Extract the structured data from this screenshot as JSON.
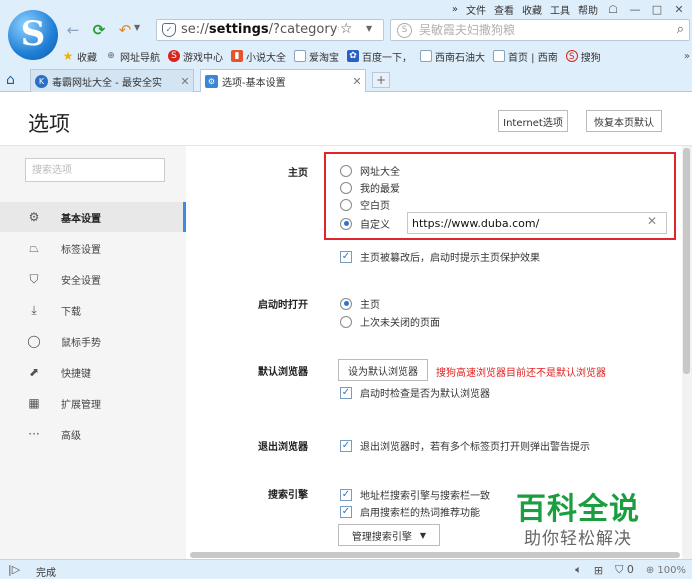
{
  "menubar": {
    "expand": "»",
    "items": [
      "文件",
      "查看",
      "收藏",
      "工具",
      "帮助"
    ]
  },
  "window": {
    "shirt": "☖",
    "minimize": "—",
    "restore": "□",
    "close": "✕"
  },
  "nav": {
    "address_prefix": "se://",
    "address_bold": "settings",
    "address_suffix": "/?category=ge"
  },
  "search": {
    "placeholder": "吴敏霞夫妇撒狗粮"
  },
  "bookmarks": {
    "items": [
      "收藏",
      "网址导航",
      "游戏中心",
      "小说大全",
      "爱淘宝",
      "百度一下，",
      "西南石油大",
      "首页 | 西南",
      "搜狗"
    ],
    "more": "»"
  },
  "tabs": [
    {
      "label": "毒霸网址大全 - 最安全实"
    },
    {
      "label": "选项-基本设置"
    }
  ],
  "page": {
    "title": "选项",
    "internet_options": "Internet选项",
    "restore_default": "恢复本页默认"
  },
  "sidebar": {
    "search_placeholder": "搜索选项",
    "items": [
      {
        "label": "基本设置",
        "icon": "gear-icon"
      },
      {
        "label": "标签设置",
        "icon": "tab-icon"
      },
      {
        "label": "安全设置",
        "icon": "shield-icon"
      },
      {
        "label": "下载",
        "icon": "download-icon"
      },
      {
        "label": "鼠标手势",
        "icon": "mouse-icon"
      },
      {
        "label": "快捷键",
        "icon": "shortcut-icon"
      },
      {
        "label": "扩展管理",
        "icon": "extensions-icon"
      },
      {
        "label": "高级",
        "icon": "more-icon"
      }
    ]
  },
  "settings": {
    "homepage": {
      "label": "主页",
      "options": [
        "网址大全",
        "我的最爱",
        "空白页",
        "自定义"
      ],
      "selected": "自定义",
      "custom_url": "https://www.duba.com/",
      "protect_check": "主页被篡改后，启动时提示主页保护效果"
    },
    "startup": {
      "label": "启动时打开",
      "options": [
        "主页",
        "上次未关闭的页面"
      ],
      "selected": "主页"
    },
    "default_browser": {
      "label": "默认浏览器",
      "button": "设为默认浏览器",
      "warning": "搜狗高速浏览器目前还不是默认浏览器",
      "check": "启动时检查是否为默认浏览器"
    },
    "exit_browser": {
      "label": "退出浏览器",
      "check": "退出浏览器时，若有多个标签页打开则弹出警告提示"
    },
    "search_engine": {
      "label": "搜索引擎",
      "check1": "地址栏搜索引擎与搜索栏一致",
      "check2": "启用搜索栏的热词推荐功能",
      "button": "管理搜索引擎"
    }
  },
  "watermark": {
    "title": "百科全说",
    "subtitle": "助你轻松解决"
  },
  "status": {
    "text": "完成",
    "blocked_count": "0",
    "zoom": "100%"
  }
}
